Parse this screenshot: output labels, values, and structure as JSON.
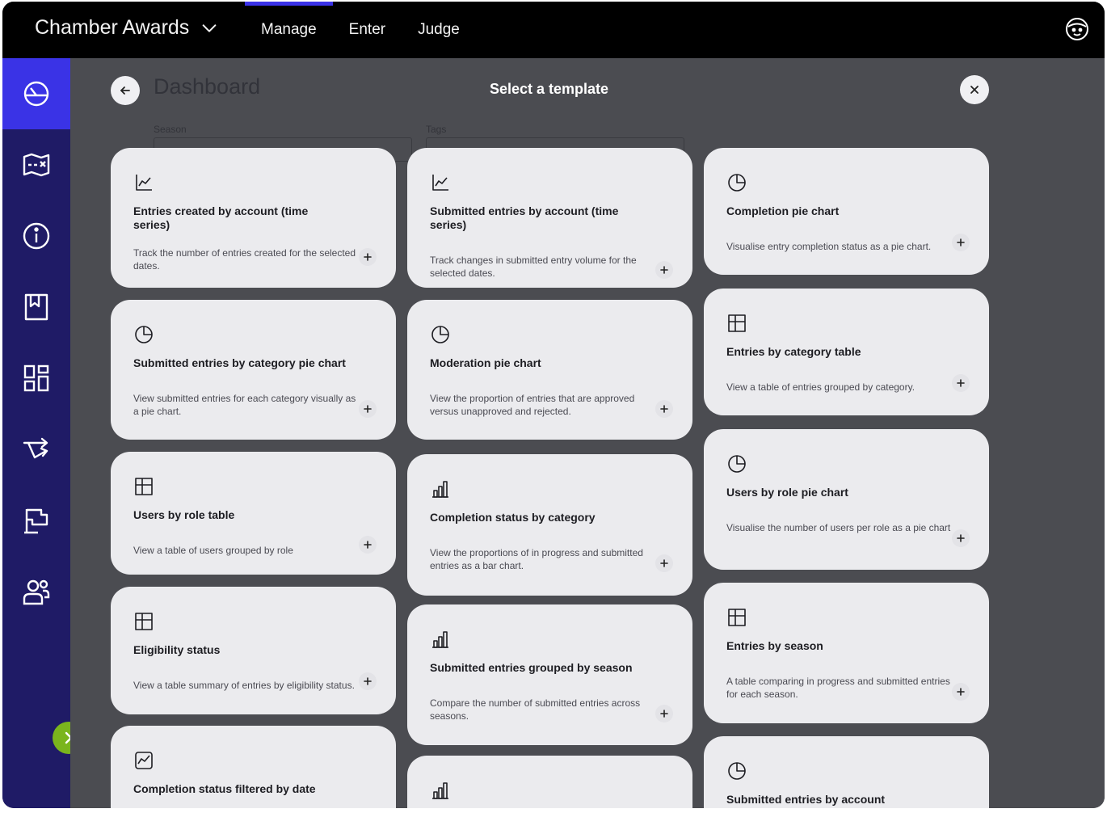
{
  "topbar": {
    "brand": "Chamber Awards",
    "tabs": [
      {
        "label": "Manage",
        "active": true
      },
      {
        "label": "Enter",
        "active": false
      },
      {
        "label": "Judge",
        "active": false
      }
    ]
  },
  "sidebar": {
    "items": [
      {
        "icon": "dashboard-gauge-icon",
        "active": true
      },
      {
        "icon": "map-icon",
        "active": false
      },
      {
        "icon": "info-icon",
        "active": false
      },
      {
        "icon": "bookmark-icon",
        "active": false
      },
      {
        "icon": "layout-grid-icon",
        "active": false
      },
      {
        "icon": "workflow-arrows-icon",
        "active": false
      },
      {
        "icon": "flag-icon",
        "active": false
      },
      {
        "icon": "users-icon",
        "active": false
      }
    ]
  },
  "page": {
    "title": "Dashboard",
    "season_label": "Season",
    "tags_label": "Tags"
  },
  "modal": {
    "title": "Select a template",
    "columns": [
      [
        {
          "icon": "line-chart-icon",
          "title": "Entries created by account (time series)",
          "description": "Track the number of entries created for the selected dates."
        },
        {
          "icon": "pie-chart-icon",
          "title": "Submitted entries by category pie chart",
          "description": "View submitted entries for each category visually as a pie chart."
        },
        {
          "icon": "table-icon",
          "title": "Users by role table",
          "description": "View a table of users grouped by role"
        },
        {
          "icon": "table-icon",
          "title": "Eligibility status",
          "description": "View a table summary of entries by eligibility status."
        },
        {
          "icon": "area-chart-icon",
          "title": "Completion status filtered by date",
          "description": ""
        }
      ],
      [
        {
          "icon": "line-chart-icon",
          "title": "Submitted entries by account (time series)",
          "description": "Track changes in submitted entry volume for the selected dates."
        },
        {
          "icon": "pie-chart-icon",
          "title": "Moderation pie chart",
          "description": "View the proportion of entries that are approved versus unapproved and rejected."
        },
        {
          "icon": "bar-chart-icon",
          "title": "Completion status by category",
          "description": "View the proportions of in progress and submitted entries as a bar chart."
        },
        {
          "icon": "bar-chart-icon",
          "title": "Submitted entries grouped by season",
          "description": "Compare the number of submitted entries across seasons."
        },
        {
          "icon": "bar-chart-icon",
          "title": "",
          "description": ""
        }
      ],
      [
        {
          "icon": "pie-chart-icon",
          "title": "Completion pie chart",
          "description": "Visualise entry completion status as a pie chart."
        },
        {
          "icon": "table-icon",
          "title": "Entries by category table",
          "description": "View a table of entries grouped by category."
        },
        {
          "icon": "pie-chart-icon",
          "title": "Users by role pie chart",
          "description": "Visualise the number of users per role as a pie chart"
        },
        {
          "icon": "table-icon",
          "title": "Entries by season",
          "description": "A table comparing in progress and submitted entries for each season."
        },
        {
          "icon": "pie-chart-icon",
          "title": "Submitted entries by account",
          "description": ""
        }
      ]
    ]
  }
}
